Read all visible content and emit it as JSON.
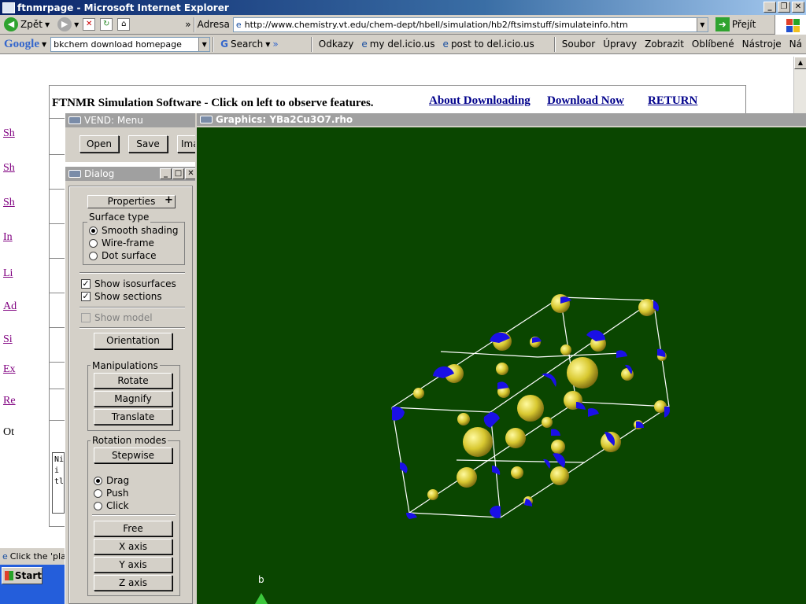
{
  "window": {
    "title": "ftnmrpage - Microsoft Internet Explorer"
  },
  "nav": {
    "back_label": "Zpět",
    "address_label": "Adresa",
    "url": "http://www.chemistry.vt.edu/chem-dept/hbell/simulation/hb2/ftsimstuff/simulateinfo.htm",
    "go_label": "Přejít",
    "chevron": "»"
  },
  "google_bar": {
    "logo": "Google",
    "query": "bkchem download homepage",
    "search_label": "Search",
    "chevron": "»"
  },
  "links_bar": {
    "links_label": "Odkazy",
    "links": [
      "my del.icio.us",
      "post to del.icio.us"
    ]
  },
  "menu_bar": {
    "items": [
      "Soubor",
      "Úpravy",
      "Zobrazit",
      "Oblíbené",
      "Nástroje",
      "Ná"
    ]
  },
  "webpage": {
    "heading": "FTNMR Simulation Software - Click on left to observe features.",
    "links": [
      "About Downloading",
      "Download Now",
      "RETURN"
    ],
    "left_link_fragments": [
      "Sh",
      "Sh",
      "Sh",
      "In",
      "Li",
      "Ad",
      "Si",
      "Ex",
      "Re",
      "Ot"
    ],
    "textbox_lines": [
      "Ni",
      "i",
      "tl"
    ]
  },
  "status": {
    "text": "Click the 'pla"
  },
  "taskbar": {
    "start_label": "Start"
  },
  "vend_menu": {
    "title": "VEND: Menu",
    "buttons": [
      "Open",
      "Save",
      "Ima"
    ]
  },
  "dialog": {
    "title": "Dialog",
    "properties_label": "Properties",
    "surface_type": {
      "label": "Surface type",
      "options": [
        "Smooth shading",
        "Wire-frame",
        "Dot surface"
      ],
      "selected": "Smooth shading"
    },
    "show_isosurfaces": {
      "label": "Show isosurfaces",
      "checked": true
    },
    "show_sections": {
      "label": "Show sections",
      "checked": true
    },
    "show_model": {
      "label": "Show model",
      "checked": false,
      "disabled": true
    },
    "orientation_label": "Orientation",
    "manipulations": {
      "label": "Manipulations",
      "buttons": [
        "Rotate",
        "Magnify",
        "Translate"
      ]
    },
    "rotation_modes": {
      "label": "Rotation modes",
      "stepwise_label": "Stepwise",
      "options": [
        "Drag",
        "Push",
        "Click"
      ],
      "selected": "Drag"
    },
    "axis_buttons": [
      "Free",
      "X axis",
      "Y axis",
      "Z axis"
    ]
  },
  "graphics": {
    "title": "Graphics: YBa2Cu3O7.rho",
    "axis_label": "b",
    "colors": {
      "background": "#0a4600",
      "isosurface": "#d8c830",
      "section": "#1a10e6",
      "edge": "#ffffff"
    }
  }
}
